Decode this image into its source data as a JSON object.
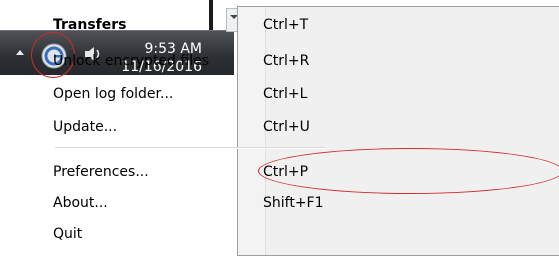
{
  "taskbar": {
    "time": "9:53 AM",
    "date": "11/16/2016",
    "icons": {
      "tray_arrow": "chevron-up-icon",
      "app": "app-g-icon",
      "volume": "speaker-icon"
    },
    "highlight_color": "#d12a2a"
  },
  "menu": {
    "items": [
      {
        "label": "Transfers",
        "shortcut": "Ctrl+T",
        "bold": true
      },
      {
        "label": "Unlock encrypted files",
        "shortcut": "Ctrl+R"
      },
      {
        "label": "Open log folder...",
        "shortcut": "Ctrl+L"
      },
      {
        "label": "Update...",
        "shortcut": "Ctrl+U"
      },
      {
        "label": "Preferences...",
        "shortcut": "Ctrl+P"
      },
      {
        "label": "About...",
        "shortcut": "Shift+F1"
      },
      {
        "label": "Quit",
        "shortcut": ""
      }
    ]
  }
}
